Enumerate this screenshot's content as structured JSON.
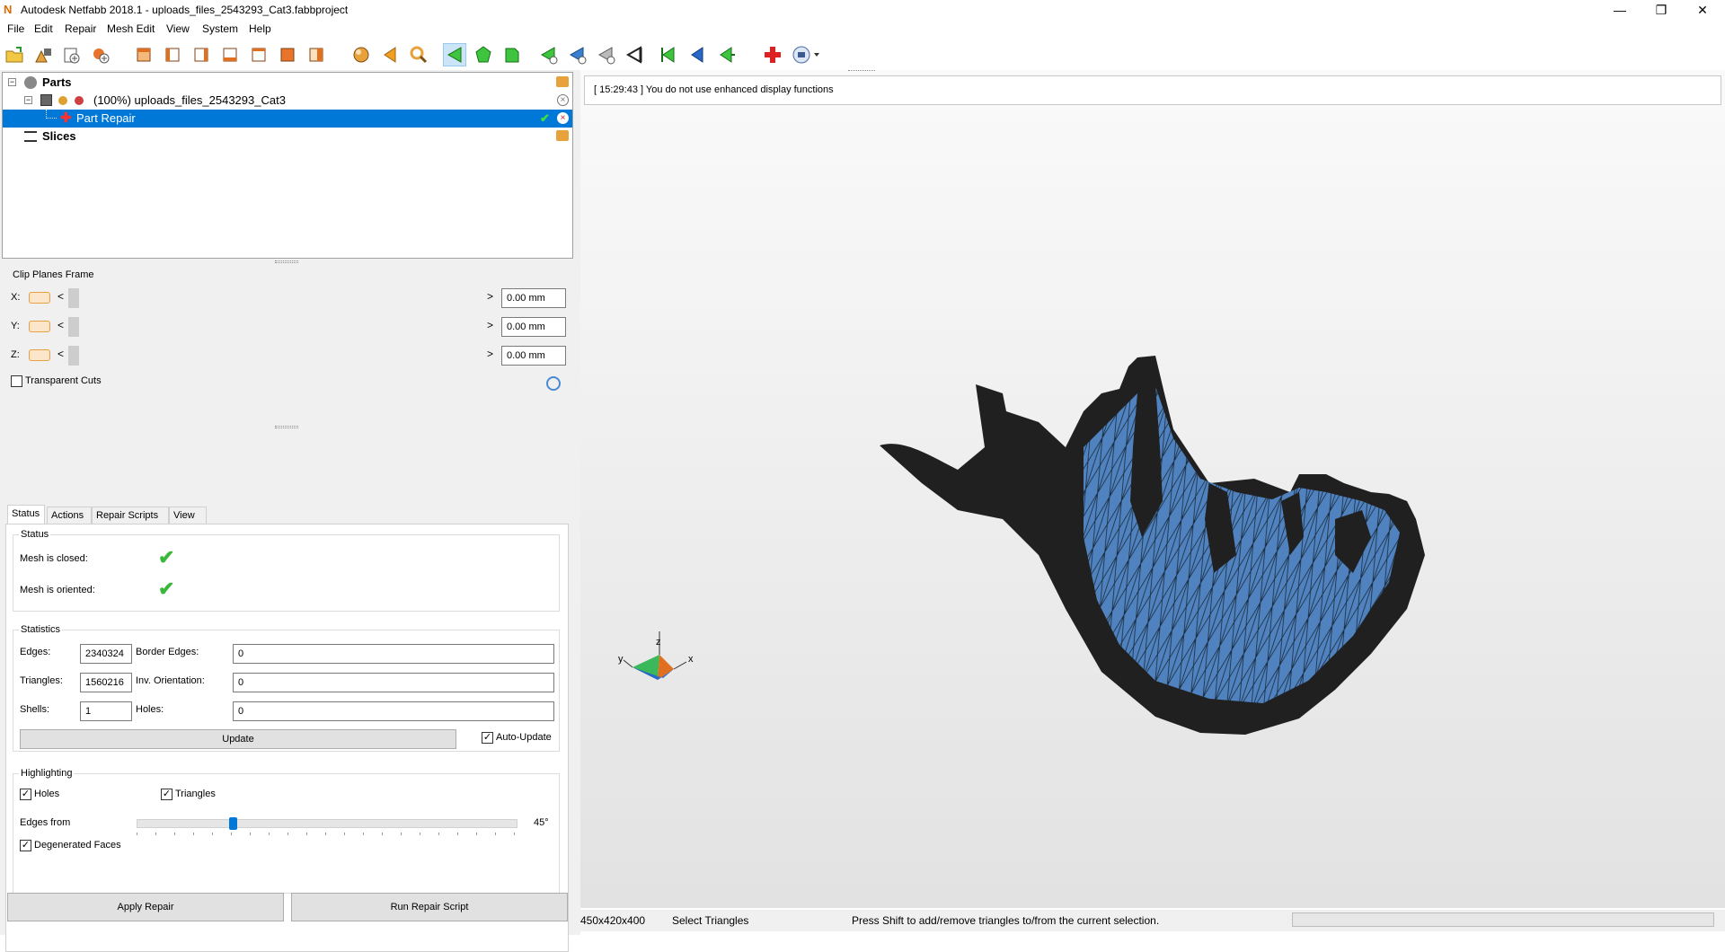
{
  "window": {
    "app_icon": "N",
    "title": "Autodesk Netfabb 2018.1 - uploads_files_2543293_Cat3.fabbproject",
    "controls": [
      "—",
      "❐",
      "✕"
    ]
  },
  "menu": [
    "File",
    "Edit",
    "Repair",
    "Mesh Edit",
    "View",
    "System",
    "Help"
  ],
  "toolbar": {
    "icons": [
      "open-project-icon",
      "import-part-icon",
      "add-part-icon",
      "new-part-icon",
      "view-front-icon",
      "view-back-icon",
      "view-left-icon",
      "view-right-icon",
      "view-top-icon",
      "view-bottom-icon",
      "view-iso-icon",
      "sphere-shading-icon",
      "select-arrow-icon",
      "zoom-icon",
      "select-triangles-icon",
      "select-surface-icon",
      "select-shell-icon",
      "add-triangle-icon",
      "remove-triangle-icon",
      "move-triangle-icon",
      "invert-icon",
      "flip-icon",
      "left-icon",
      "right-icon",
      "repair-cross-icon",
      "help-dropdown-icon"
    ]
  },
  "tree": {
    "parts_label": "Parts",
    "part_name": "(100%) uploads_files_2543293_Cat3",
    "repair_label": "Part Repair",
    "slices_label": "Slices"
  },
  "clip": {
    "title": "Clip Planes Frame",
    "rows": [
      {
        "axis": "X:",
        "value": "0.00 mm"
      },
      {
        "axis": "Y:",
        "value": "0.00 mm"
      },
      {
        "axis": "Z:",
        "value": "0.00 mm"
      }
    ],
    "transparent_label": "Transparent Cuts",
    "transparent_checked": false
  },
  "tabs": [
    "Status",
    "Actions",
    "Repair Scripts",
    "View"
  ],
  "status": {
    "group_title": "Status",
    "closed_label": "Mesh is closed:",
    "oriented_label": "Mesh is oriented:"
  },
  "statistics": {
    "group_title": "Statistics",
    "edges_label": "Edges:",
    "edges": "2340324",
    "border_edges_label": "Border Edges:",
    "border_edges": "0",
    "triangles_label": "Triangles:",
    "triangles": "1560216",
    "inv_orientation_label": "Inv. Orientation:",
    "inv_orientation": "0",
    "shells_label": "Shells:",
    "shells": "1",
    "holes_label": "Holes:",
    "holes": "0",
    "update_label": "Update",
    "auto_update_label": "Auto-Update",
    "auto_update_checked": true
  },
  "highlighting": {
    "group_title": "Highlighting",
    "holes_label": "Holes",
    "holes_checked": true,
    "triangles_label": "Triangles",
    "triangles_checked": true,
    "edges_from_label": "Edges from",
    "edges_from_value": "45°",
    "edges_from_level": 0.25,
    "degenerated_label": "Degenerated Faces",
    "degenerated_checked": true
  },
  "buttons": {
    "apply_repair": "Apply Repair",
    "run_script": "Run Repair Script"
  },
  "viewport": {
    "log": "[ 15:29:43 ] You do not use enhanced display functions",
    "axes": {
      "z": "z",
      "y": "y",
      "x": "x"
    },
    "colors": {
      "mesh_dark": "#202020",
      "mesh_blue": "#4f82bf"
    }
  },
  "statusbar": {
    "dims": "450x420x400",
    "mode": "Select Triangles",
    "hint": "Press Shift to add/remove triangles to/from the current selection."
  }
}
